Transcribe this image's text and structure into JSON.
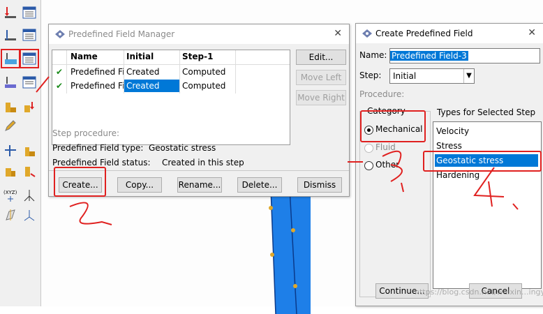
{
  "manager": {
    "title": "Predefined Field Manager",
    "columns": [
      "Name",
      "Initial",
      "Step-1"
    ],
    "rows": [
      {
        "name": "Predefined Fi",
        "initial": "Created",
        "step1": "Computed"
      },
      {
        "name": "Predefined Fi",
        "initial": "Created",
        "step1": "Computed"
      }
    ],
    "side_buttons": {
      "edit": "Edit...",
      "move_left": "Move Left",
      "move_right": "Move Right"
    },
    "step_procedure_label": "Step procedure:",
    "field_type_label": "Predefined Field type:",
    "field_type_value": "Geostatic stress",
    "field_status_label": "Predefined Field status:",
    "field_status_value": "Created in this step",
    "buttons": {
      "create": "Create...",
      "copy": "Copy...",
      "rename": "Rename...",
      "delete": "Delete...",
      "dismiss": "Dismiss"
    }
  },
  "create": {
    "title": "Create Predefined Field",
    "name_label": "Name:",
    "name_value": "Predefined Field-3",
    "step_label": "Step:",
    "step_value": "Initial",
    "procedure_label": "Procedure:",
    "category_label": "Category",
    "categories": [
      "Mechanical",
      "Fluid",
      "Other"
    ],
    "types_label": "Types for Selected Step",
    "types": [
      "Velocity",
      "Stress",
      "Geostatic stress",
      "Hardening"
    ],
    "continue_label": "Continue...",
    "cancel_label": "Cancel"
  },
  "watermark": "https://blog.csdn.net/weixin...ingyi",
  "colors": {
    "selection": "#0078d7",
    "annotation": "#e0201f",
    "part": "#1e7fe8"
  }
}
